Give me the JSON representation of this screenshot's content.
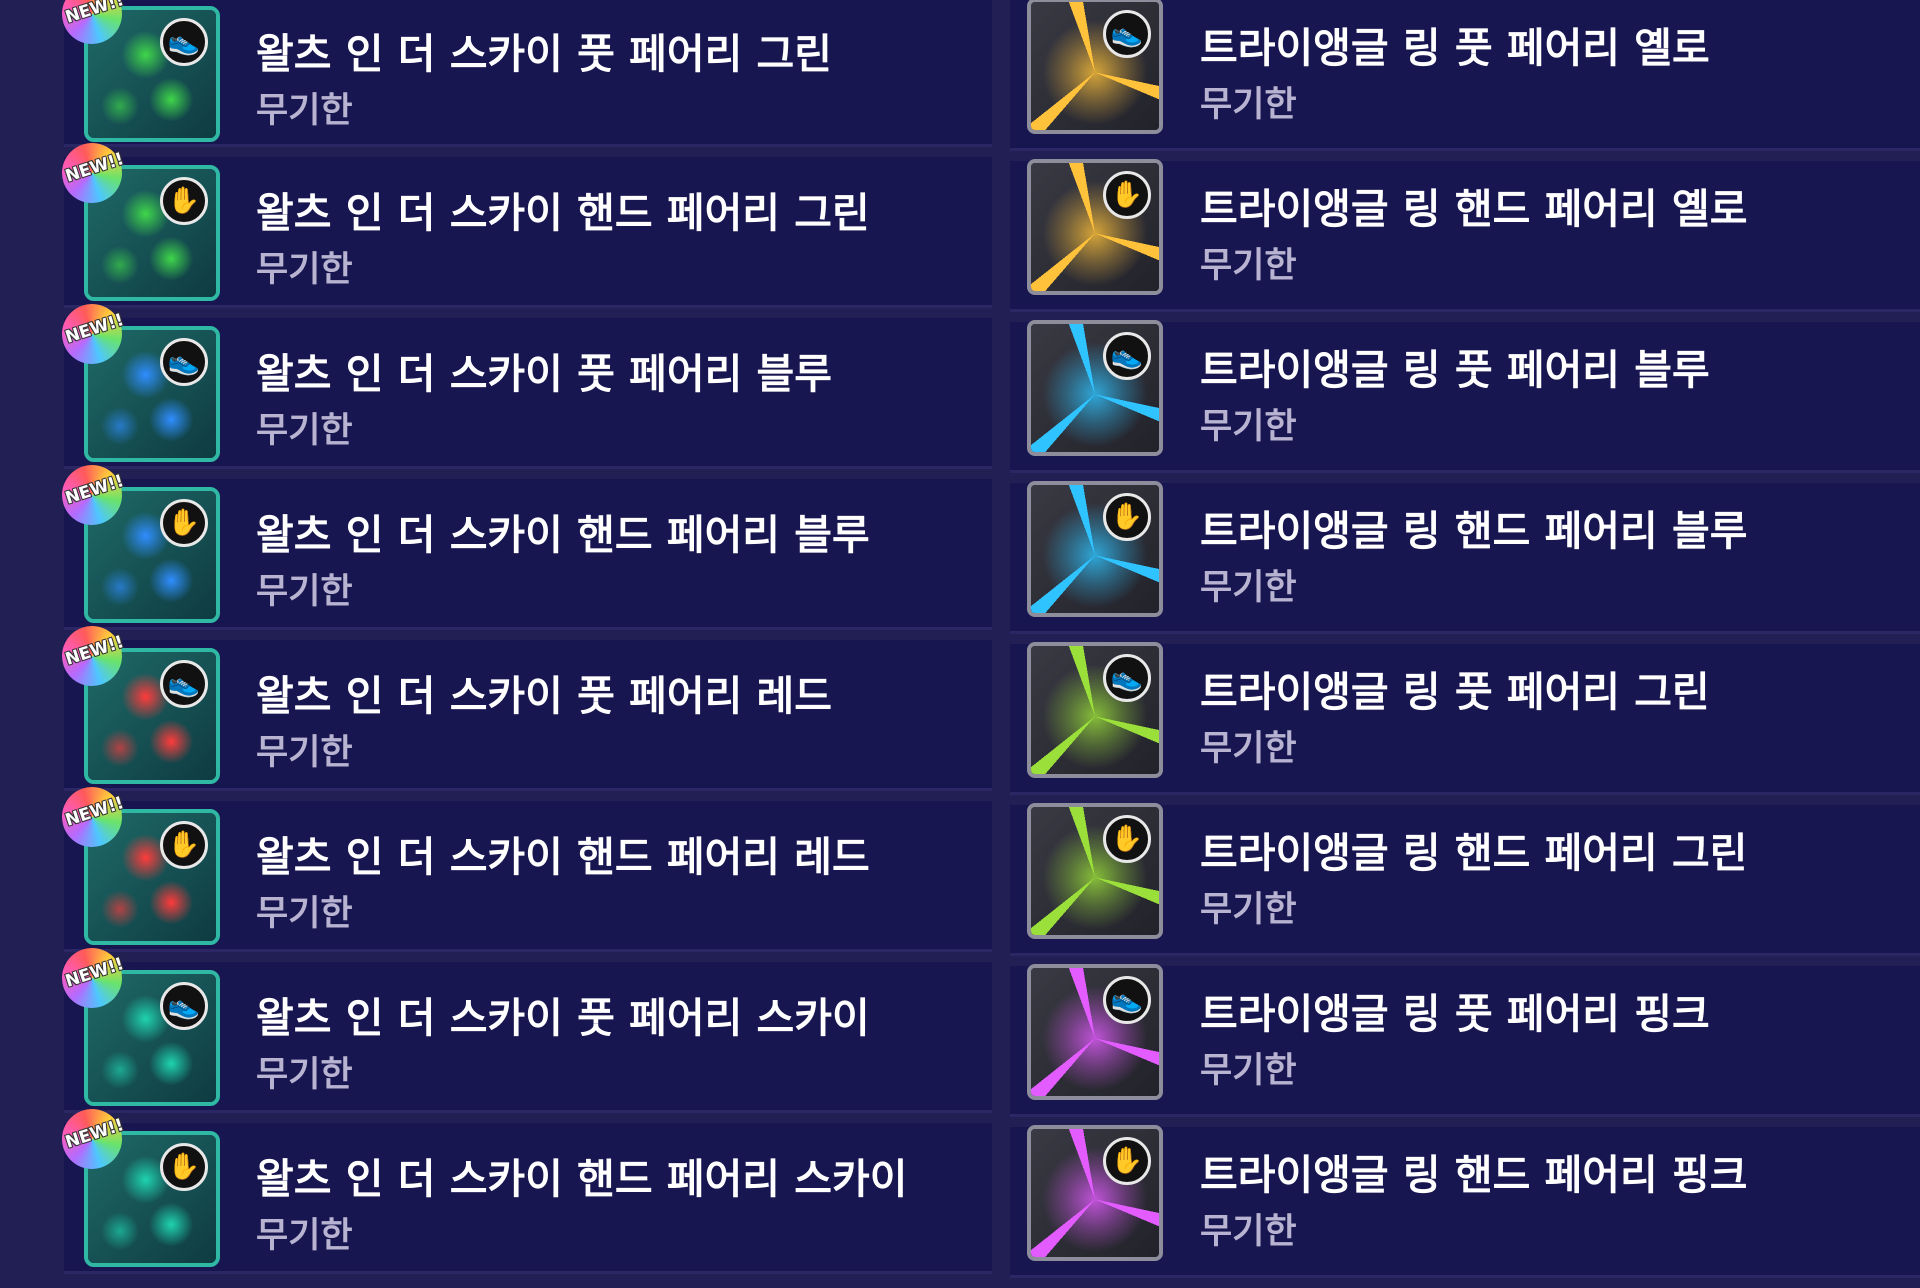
{
  "left_items": [
    {
      "name": "왈츠 인 더 스카이 풋 페어리 그린",
      "duration": "무기한",
      "badge": "NEW!!",
      "mode_icon": "foot-icon",
      "color": "#3fd64a"
    },
    {
      "name": "왈츠 인 더 스카이 핸드 페어리 그린",
      "duration": "무기한",
      "badge": "NEW!!",
      "mode_icon": "hand-icon",
      "color": "#3fd64a"
    },
    {
      "name": "왈츠 인 더 스카이 풋 페어리 블루",
      "duration": "무기한",
      "badge": "NEW!!",
      "mode_icon": "foot-icon",
      "color": "#2f8dff"
    },
    {
      "name": "왈츠 인 더 스카이 핸드 페어리 블루",
      "duration": "무기한",
      "badge": "NEW!!",
      "mode_icon": "hand-icon",
      "color": "#2f8dff"
    },
    {
      "name": "왈츠 인 더 스카이 풋 페어리 레드",
      "duration": "무기한",
      "badge": "NEW!!",
      "mode_icon": "foot-icon",
      "color": "#ff3b3b"
    },
    {
      "name": "왈츠 인 더 스카이 핸드 페어리 레드",
      "duration": "무기한",
      "badge": "NEW!!",
      "mode_icon": "hand-icon",
      "color": "#ff3b3b"
    },
    {
      "name": "왈츠 인 더 스카이 풋 페어리 스카이",
      "duration": "무기한",
      "badge": "NEW!!",
      "mode_icon": "foot-icon",
      "color": "#1fd3b0"
    },
    {
      "name": "왈츠 인 더 스카이 핸드 페어리 스카이",
      "duration": "무기한",
      "badge": "NEW!!",
      "mode_icon": "hand-icon",
      "color": "#1fd3b0"
    }
  ],
  "right_items": [
    {
      "name": "트라이앵글 링 풋 페어리 옐로",
      "duration": "무기한",
      "mode_icon": "foot-icon",
      "color": "#ffc23a"
    },
    {
      "name": "트라이앵글 링 핸드 페어리 옐로",
      "duration": "무기한",
      "mode_icon": "hand-icon",
      "color": "#ffc23a"
    },
    {
      "name": "트라이앵글 링 풋 페어리 블루",
      "duration": "무기한",
      "mode_icon": "foot-icon",
      "color": "#2fc4ff"
    },
    {
      "name": "트라이앵글 링 핸드 페어리 블루",
      "duration": "무기한",
      "mode_icon": "hand-icon",
      "color": "#2fc4ff"
    },
    {
      "name": "트라이앵글 링 풋 페어리 그린",
      "duration": "무기한",
      "mode_icon": "foot-icon",
      "color": "#9be03a"
    },
    {
      "name": "트라이앵글 링 핸드 페어리 그린",
      "duration": "무기한",
      "mode_icon": "hand-icon",
      "color": "#9be03a"
    },
    {
      "name": "트라이앵글 링 풋 페어리 핑크",
      "duration": "무기한",
      "mode_icon": "foot-icon",
      "color": "#e35cff"
    },
    {
      "name": "트라이앵글 링 핸드 페어리 핑크",
      "duration": "무기한",
      "mode_icon": "hand-icon",
      "color": "#e35cff"
    }
  ]
}
